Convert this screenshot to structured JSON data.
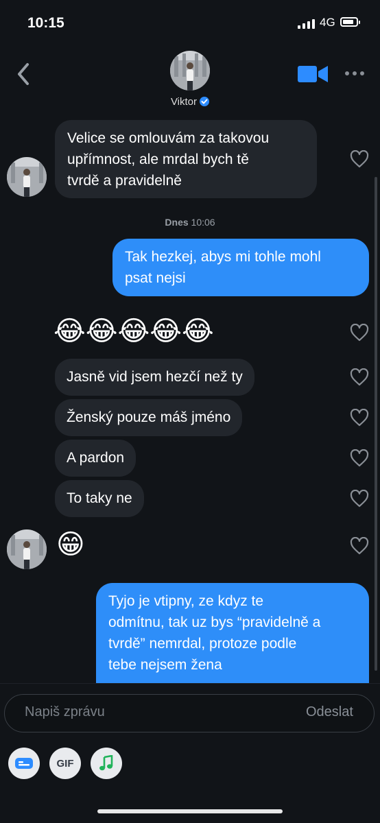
{
  "status_bar": {
    "time": "10:15",
    "network": "4G"
  },
  "header": {
    "contact_name": "Viktor"
  },
  "messages": {
    "m1": [
      "Velice se omlouvám za takovou",
      "upřímnost, ale mrdal bych tě",
      "tvrdě a pravidelně"
    ],
    "timestamp_day": "Dnes",
    "timestamp_time": "10:06",
    "m2": [
      "Tak hezkej, abys mi tohle mohl",
      "psat nejsi"
    ],
    "m3": "😂😂😂😂😂",
    "m4": "Jasně vid jsem hezčí než ty",
    "m5": "Ženský pouze máš jméno",
    "m6": "A pardon",
    "m7": "To taky ne",
    "m8": "😁",
    "m9": [
      "Tyjo je vtipny, ze kdyz te",
      "odmítnu, tak uz bys “pravidelně a",
      "tvrdě” nemrdal, protoze podle",
      "tebe nejsem žena"
    ]
  },
  "composer": {
    "placeholder": "Napiš zprávu",
    "send_label": "Odeslat",
    "gif_label": "GIF"
  },
  "colors": {
    "background": "#111418",
    "incoming_bubble": "#22262c",
    "outgoing_bubble": "#2e8ef9",
    "accent": "#2d8cff",
    "music_icon": "#21b35a"
  },
  "icons": [
    "back-icon",
    "verified-icon",
    "video-call-icon",
    "more-icon",
    "heart-icon",
    "card-icon",
    "gif-icon",
    "music-icon"
  ]
}
